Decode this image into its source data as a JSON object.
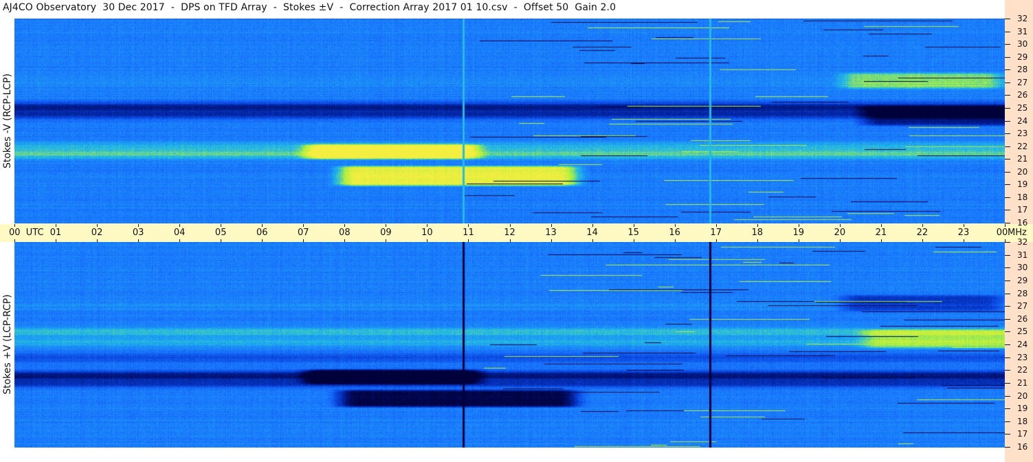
{
  "title": "AJ4CO Observatory  30 Dec 2017  -  DPS on TFD Array  -  Stokes ±V  -  Correction Array 2017 01 10.csv  -  Offset 50  Gain 2.0",
  "colors": {
    "page_background": "#ffffff",
    "time_axis_band": "#fff9c4",
    "frequency_axis_band": "#ffe0c8",
    "colormap": [
      "#00003a",
      "#001a8c",
      "#0a46e0",
      "#1a78ff",
      "#20b8e8",
      "#a8ef40",
      "#f4ee40"
    ]
  },
  "chart_data": {
    "type": "heatmap",
    "title": "AJ4CO Observatory  30 Dec 2017  -  DPS on TFD Array  -  Stokes ±V  -  Correction Array 2017 01 10.csv  -  Offset 50  Gain 2.0",
    "x_tick_labels": [
      "00  UTC",
      "01",
      "02",
      "03",
      "04",
      "05",
      "06",
      "07",
      "08",
      "09",
      "10",
      "11",
      "12",
      "13",
      "14",
      "15",
      "16",
      "17",
      "18",
      "19",
      "20",
      "21",
      "22",
      "23",
      "00"
    ],
    "x_unit_label": "MHz",
    "xlim": [
      0,
      24
    ],
    "ylim": [
      16,
      32
    ],
    "y_tick_labels": [
      "16",
      "17",
      "18",
      "19",
      "20",
      "21",
      "22",
      "23",
      "24",
      "25",
      "26",
      "27",
      "28",
      "29",
      "30",
      "31",
      "32"
    ],
    "panels": [
      {
        "name": "Stokes -V (RCP-LCP)",
        "freq_bands": [
          {
            "f": 25.1,
            "v": -0.7
          },
          {
            "f": 24.5,
            "v": -0.55
          },
          {
            "f": 22.0,
            "v": 0.3
          },
          {
            "f": 21.4,
            "v": 0.45
          },
          {
            "f": 20.2,
            "v": -0.05
          },
          {
            "f": 27.0,
            "v": 0.08
          }
        ],
        "events": [
          {
            "t0": 8.3,
            "t1": 13.2,
            "f0": 19.1,
            "f1": 20.3,
            "v": 0.95
          },
          {
            "t0": 7.5,
            "t1": 10.8,
            "f0": 21.2,
            "f1": 22.0,
            "v": 0.9
          },
          {
            "t0": 20.5,
            "t1": 23.5,
            "f0": 26.7,
            "f1": 27.6,
            "v": 0.5
          },
          {
            "t0": 21.0,
            "t1": 24.0,
            "f0": 23.8,
            "f1": 25.0,
            "v": -0.65
          }
        ],
        "vertical_lines": [
          {
            "t": 10.88,
            "v": 0.35
          },
          {
            "t": 16.87,
            "v": 0.35
          }
        ]
      },
      {
        "name": "Stokes +V (LCP-RCP)",
        "freq_bands": [
          {
            "f": 25.0,
            "v": 0.35
          },
          {
            "f": 24.2,
            "v": 0.3
          },
          {
            "f": 21.6,
            "v": -0.75
          },
          {
            "f": 21.0,
            "v": -0.5
          },
          {
            "f": 23.0,
            "v": -0.3
          },
          {
            "f": 27.0,
            "v": 0.08
          }
        ],
        "events": [
          {
            "t0": 8.3,
            "t1": 13.2,
            "f0": 19.3,
            "f1": 20.3,
            "v": -0.95
          },
          {
            "t0": 7.5,
            "t1": 10.8,
            "f0": 21.1,
            "f1": 21.9,
            "v": -0.85
          },
          {
            "t0": 20.5,
            "t1": 23.5,
            "f0": 26.8,
            "f1": 27.7,
            "v": -0.5
          },
          {
            "t0": 21.0,
            "t1": 24.0,
            "f0": 23.9,
            "f1": 25.0,
            "v": 0.45
          }
        ],
        "vertical_lines": [
          {
            "t": 10.88,
            "v": -1.0
          },
          {
            "t": 16.87,
            "v": -1.0
          }
        ]
      }
    ]
  }
}
